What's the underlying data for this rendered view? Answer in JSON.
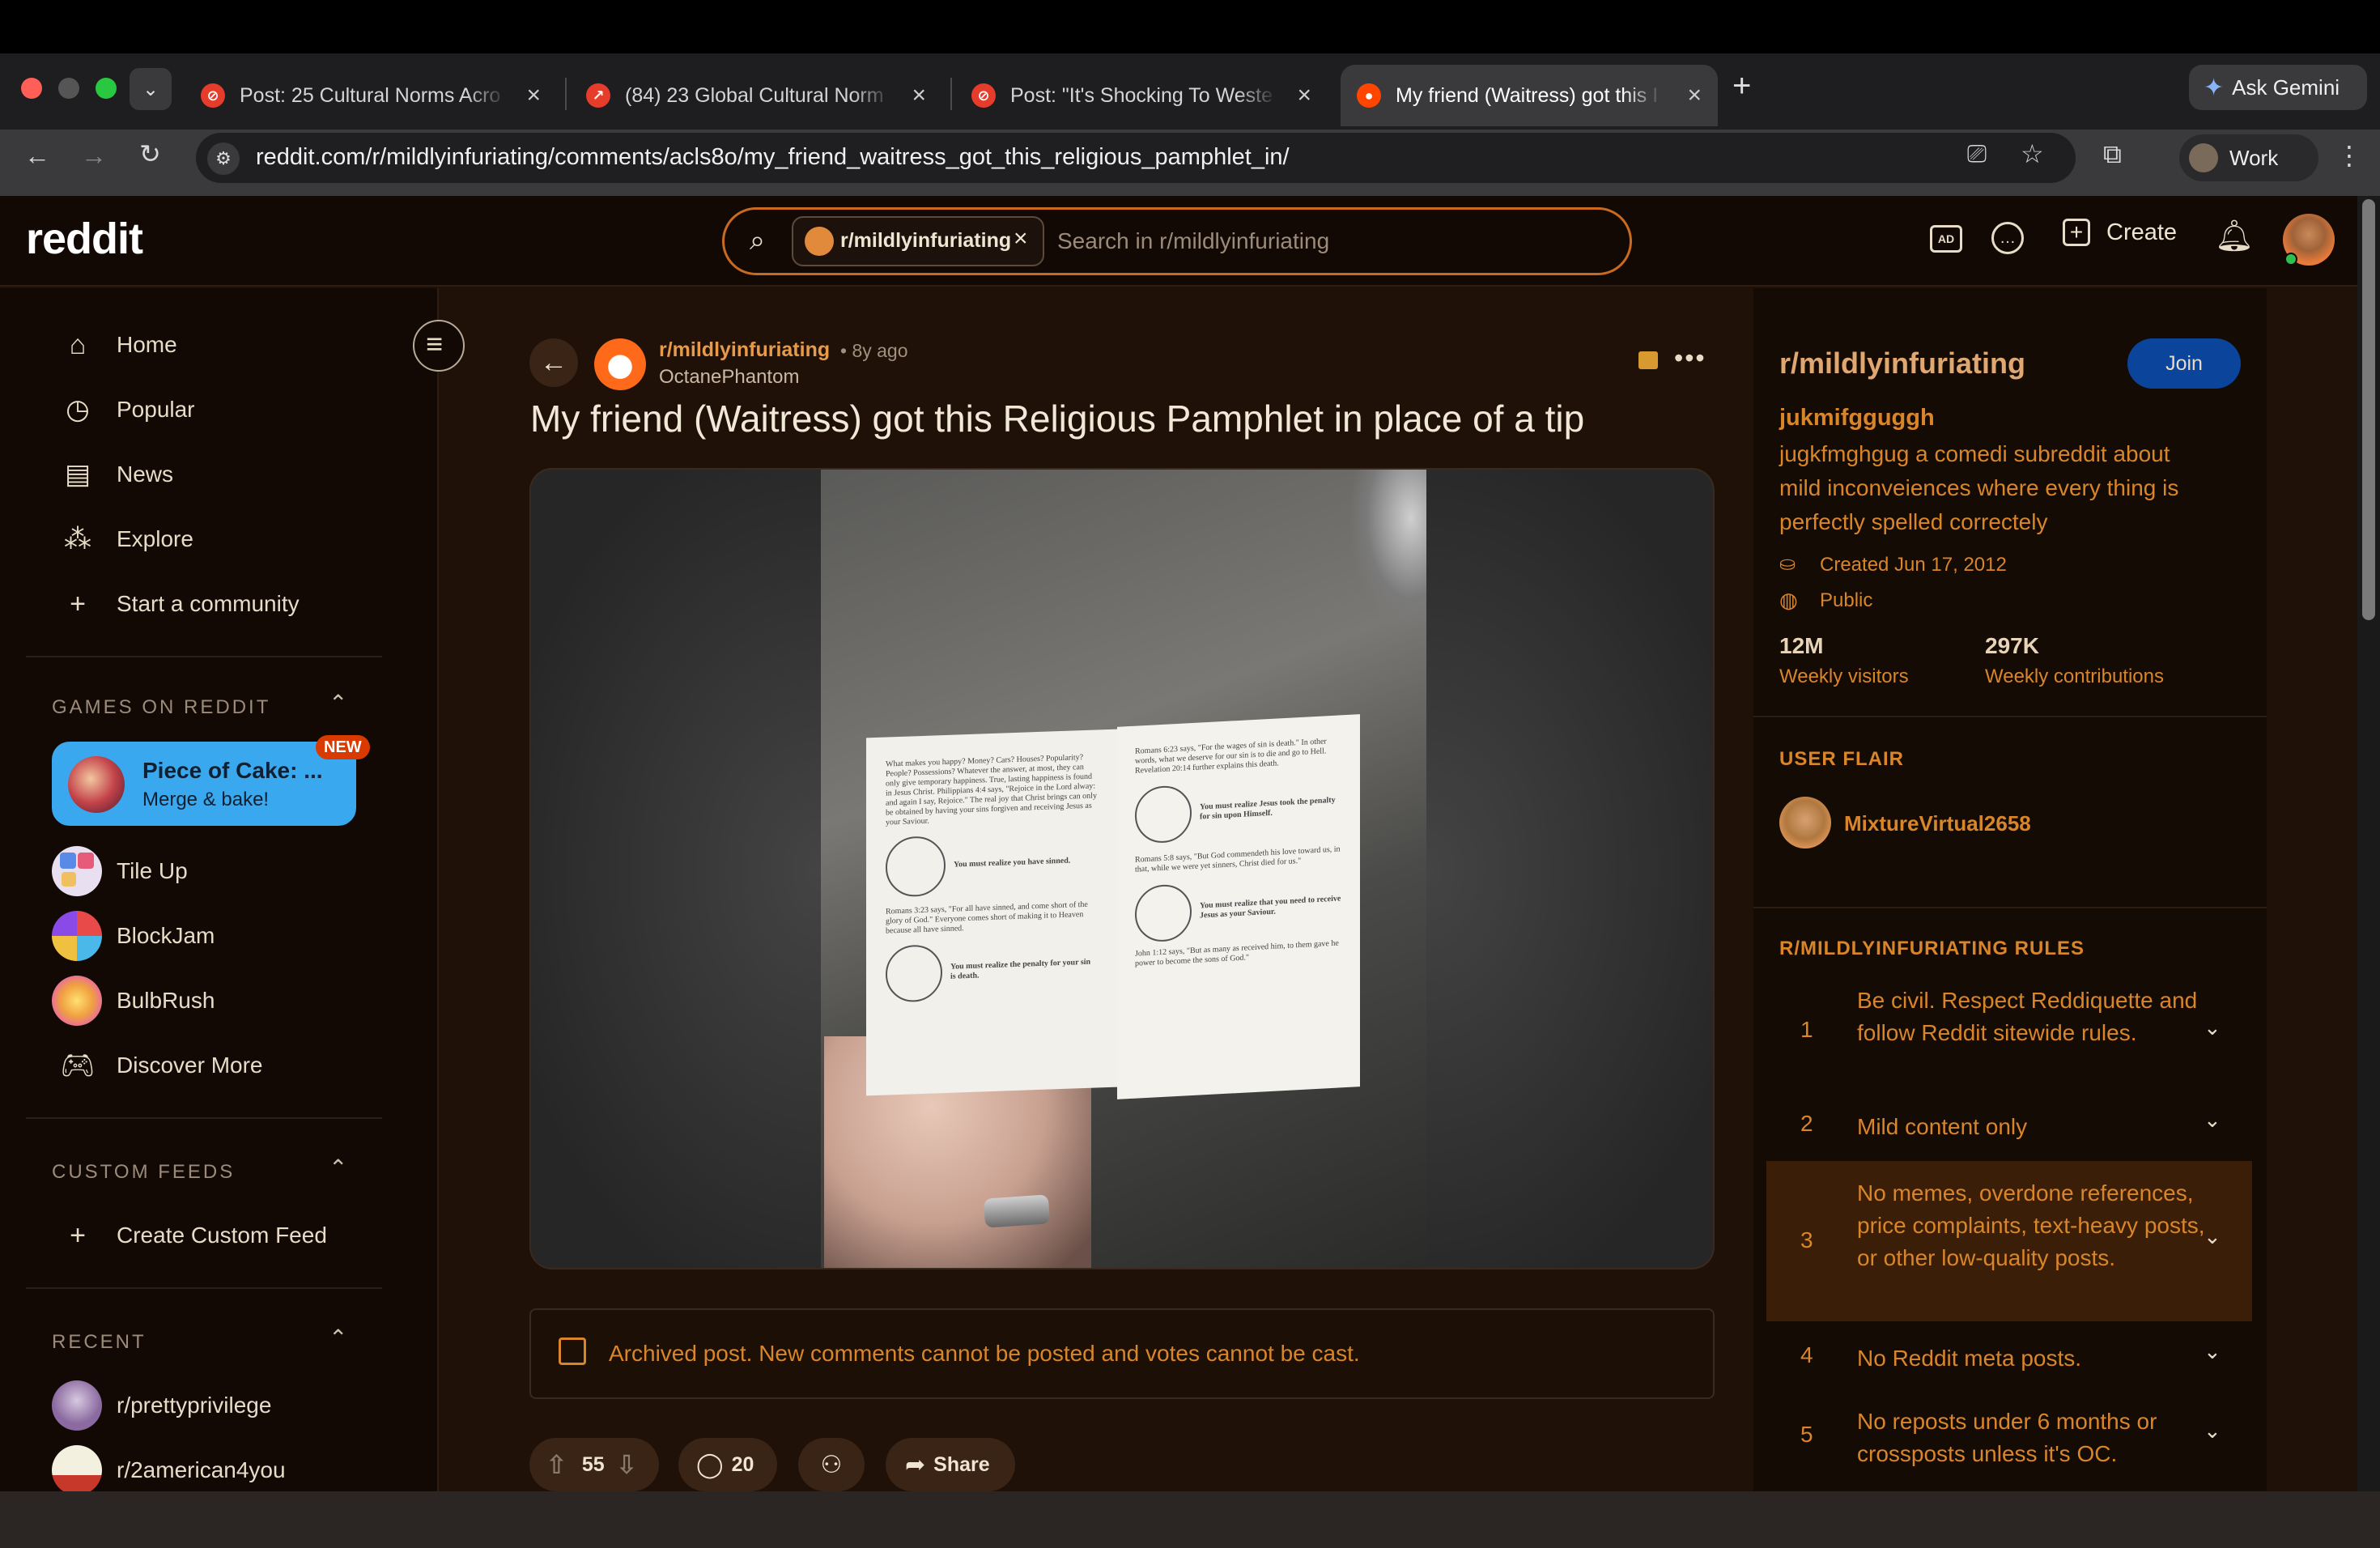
{
  "browser": {
    "tabs": [
      {
        "title": "Post: 25 Cultural Norms Acro",
        "active": false
      },
      {
        "title": "(84) 23 Global Cultural Norm",
        "active": false
      },
      {
        "title": "Post: \"It's Shocking To Weste",
        "active": false
      },
      {
        "title": "My friend (Waitress) got this I",
        "active": true
      }
    ],
    "new_tab": "+",
    "ask_gemini": "Ask Gemini",
    "url": "reddit.com/r/mildlyinfuriating/comments/acls8o/my_friend_waitress_got_this_religious_pamphlet_in/",
    "profile": "Work"
  },
  "header": {
    "logo": "reddit",
    "search_chip": "r/mildlyinfuriating",
    "search_placeholder": "Search in r/mildlyinfuriating",
    "create": "Create"
  },
  "sidebar": {
    "nav": [
      {
        "label": "Home",
        "icon": "home-icon"
      },
      {
        "label": "Popular",
        "icon": "popular-icon"
      },
      {
        "label": "News",
        "icon": "news-icon"
      },
      {
        "label": "Explore",
        "icon": "explore-icon"
      },
      {
        "label": "Start a community",
        "icon": "plus-icon"
      }
    ],
    "games_header": "GAMES ON REDDIT",
    "featured_game": {
      "title": "Piece of Cake: ...",
      "subtitle": "Merge & bake!",
      "badge": "NEW"
    },
    "games": [
      "Tile Up",
      "BlockJam",
      "BulbRush",
      "Discover More"
    ],
    "custom_feeds_header": "CUSTOM FEEDS",
    "create_custom_feed": "Create Custom Feed",
    "recent_header": "RECENT",
    "recent": [
      "r/prettyprivilege",
      "r/2american4you"
    ]
  },
  "post": {
    "subreddit": "r/mildlyinfuriating",
    "age": "• 8y ago",
    "author": "OctanePhantom",
    "title": "My friend (Waitress) got this Religious Pamphlet in place of a tip",
    "archived_notice": "Archived post. New comments cannot be posted and votes cannot be cast.",
    "votes": "55",
    "comments": "20",
    "share": "Share"
  },
  "community": {
    "name": "r/mildlyinfuriating",
    "join": "Join",
    "tagline": "jukmifgguggh",
    "description": "jugkfmghgug a comedi subreddit about mild inconveiences where every thing is perfectly spelled correctely",
    "created": "Created Jun 17, 2012",
    "visibility": "Public",
    "stats": [
      {
        "value": "12M",
        "label": "Weekly visitors"
      },
      {
        "value": "297K",
        "label": "Weekly contributions"
      }
    ],
    "user_flair_header": "USER FLAIR",
    "user_flair_name": "MixtureVirtual2658",
    "rules_header": "R/MILDLYINFURIATING RULES",
    "rules": [
      {
        "num": "1",
        "text": "Be civil. Respect Reddiquette and follow Reddit sitewide rules."
      },
      {
        "num": "2",
        "text": "Mild content only"
      },
      {
        "num": "3",
        "text": "No memes, overdone references, price complaints, text-heavy posts, or other low-quality posts."
      },
      {
        "num": "4",
        "text": "No Reddit meta posts."
      },
      {
        "num": "5",
        "text": "No reposts under 6 months or crossposts unless it's OC."
      }
    ]
  },
  "colors": {
    "accent": "#d9852a",
    "background": "#1f1108",
    "join_button": "#0a449b"
  }
}
